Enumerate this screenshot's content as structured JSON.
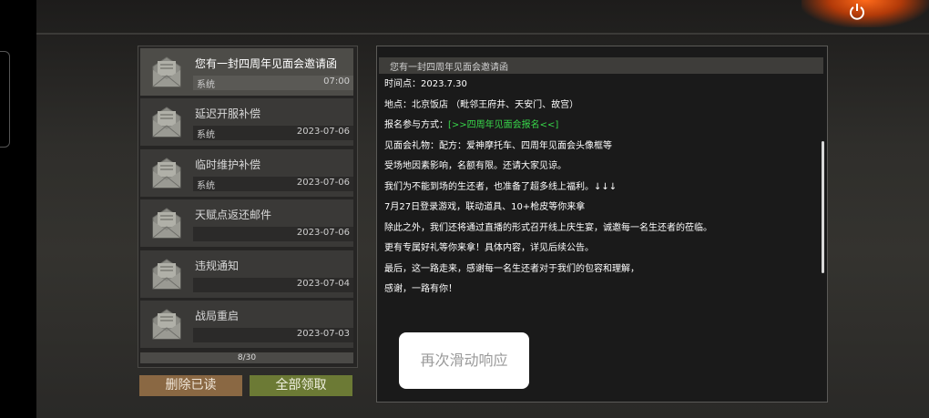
{
  "mail_list": {
    "items": [
      {
        "title": "您有一封四周年见面会邀请函",
        "sender": "系统",
        "date": "07:00",
        "active": true
      },
      {
        "title": "延迟开服补偿",
        "sender": "系统",
        "date": "2023-07-06",
        "active": false
      },
      {
        "title": "临时维护补偿",
        "sender": "系统",
        "date": "2023-07-06",
        "active": false
      },
      {
        "title": "天赋点返还邮件",
        "sender": "",
        "date": "2023-07-06",
        "active": false
      },
      {
        "title": "违规通知",
        "sender": "",
        "date": "2023-07-04",
        "active": false
      },
      {
        "title": "战局重启",
        "sender": "",
        "date": "2023-07-03",
        "active": false
      }
    ],
    "pager": "8/30",
    "icon": "envelope-icon"
  },
  "buttons": {
    "delete_read": "删除已读",
    "claim_all": "全部领取"
  },
  "detail": {
    "title": "您有一封四周年见面会邀请函",
    "lines": [
      {
        "label": "时间点：",
        "text": "2023.7.30"
      },
      {
        "label": "地点：",
        "text": "北京饭店 （毗邻王府井、天安门、故宫）"
      },
      {
        "label": "报名参与方式：",
        "link": "[>>四周年见面会报名<<]"
      },
      {
        "label": "见面会礼物：",
        "text": "配方：爱神摩托车、四周年见面会头像框等"
      },
      {
        "label": "",
        "text": "受场地因素影响，名额有限。还请大家见谅。"
      },
      {
        "label": "",
        "text": "我们为不能到场的生还者，也准备了超多线上福利。↓↓↓"
      },
      {
        "label": "",
        "text": "7月27日登录游戏，联动道具、10+枪皮等你来拿"
      },
      {
        "label": "",
        "text": "除此之外，我们还将通过直播的形式召开线上庆生宴，诚邀每一名生还者的莅临。"
      },
      {
        "label": "",
        "text": "更有专属好礼等你来拿！具体内容，详见后续公告。"
      },
      {
        "label": "",
        "text": "最后，这一路走来，感谢每一名生还者对于我们的包容和理解，"
      },
      {
        "label": "",
        "text": "感谢，一路有你！"
      }
    ]
  },
  "toast": "再次滑动响应",
  "top_icon": "power-icon",
  "colors": {
    "link": "#38d64a",
    "delete_btn": "#8a6843",
    "claim_btn": "#6c7a35"
  }
}
